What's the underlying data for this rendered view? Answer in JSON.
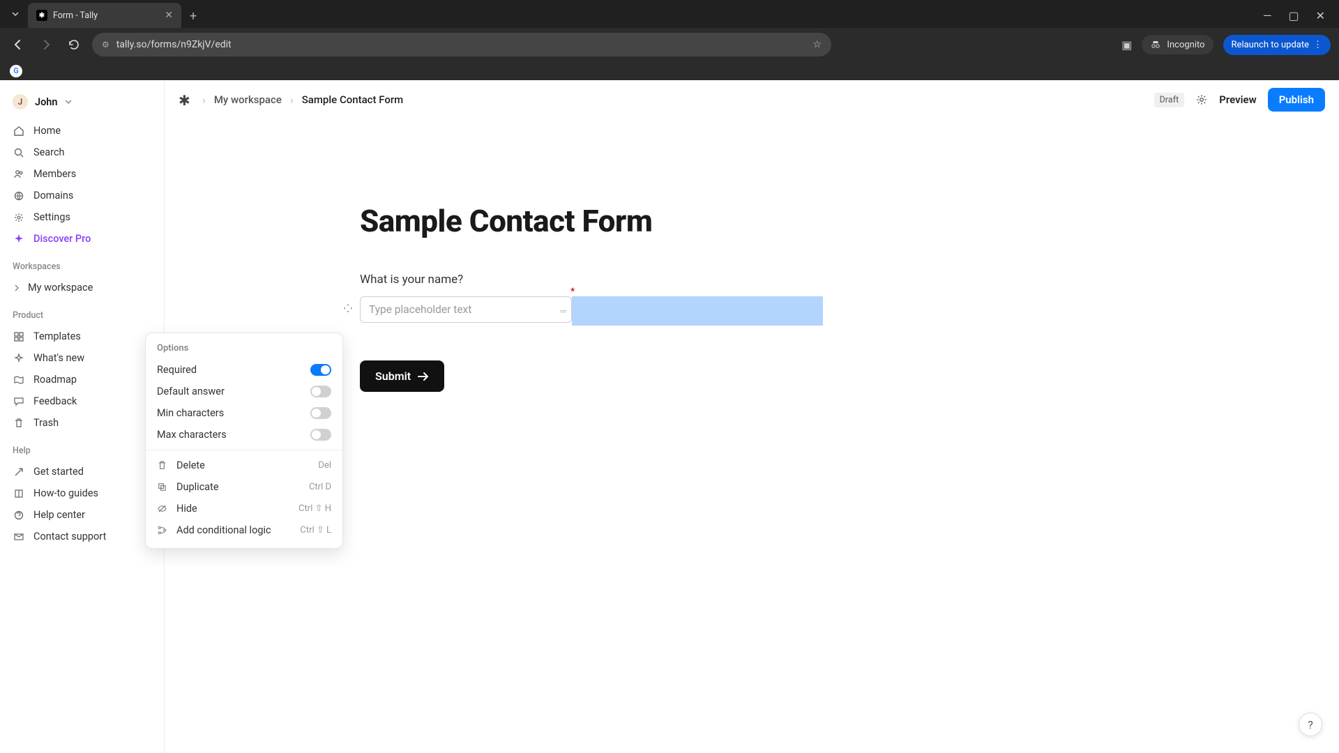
{
  "browser": {
    "tab_title": "Form - Tally",
    "url": "tally.so/forms/n9ZkjV/edit",
    "incognito_label": "Incognito",
    "update_label": "Relaunch to update"
  },
  "user": {
    "initial": "J",
    "name": "John"
  },
  "sidebar": {
    "nav": [
      {
        "label": "Home"
      },
      {
        "label": "Search"
      },
      {
        "label": "Members"
      },
      {
        "label": "Domains"
      },
      {
        "label": "Settings"
      },
      {
        "label": "Discover Pro"
      }
    ],
    "sections": {
      "workspaces": "Workspaces",
      "product": "Product",
      "help": "Help"
    },
    "workspace_item": "My workspace",
    "product": [
      {
        "label": "Templates"
      },
      {
        "label": "What's new"
      },
      {
        "label": "Roadmap"
      },
      {
        "label": "Feedback"
      },
      {
        "label": "Trash"
      }
    ],
    "help": [
      {
        "label": "Get started"
      },
      {
        "label": "How-to guides"
      },
      {
        "label": "Help center"
      },
      {
        "label": "Contact support"
      }
    ]
  },
  "topbar": {
    "crumb1": "My workspace",
    "crumb2": "Sample Contact Form",
    "draft": "Draft",
    "preview": "Preview",
    "publish": "Publish"
  },
  "form": {
    "title": "Sample Contact Form",
    "q1_label": "What is your name?",
    "q1_placeholder": "Type placeholder text",
    "submit": "Submit"
  },
  "options": {
    "title": "Options",
    "rows": [
      {
        "label": "Required",
        "on": true
      },
      {
        "label": "Default answer",
        "on": false
      },
      {
        "label": "Min characters",
        "on": false
      },
      {
        "label": "Max characters",
        "on": false
      }
    ],
    "actions": [
      {
        "label": "Delete",
        "shortcut": "Del"
      },
      {
        "label": "Duplicate",
        "shortcut": "Ctrl D"
      },
      {
        "label": "Hide",
        "shortcut": "Ctrl ⇧ H"
      },
      {
        "label": "Add conditional logic",
        "shortcut": "Ctrl ⇧ L"
      }
    ]
  },
  "help_bubble": "?"
}
